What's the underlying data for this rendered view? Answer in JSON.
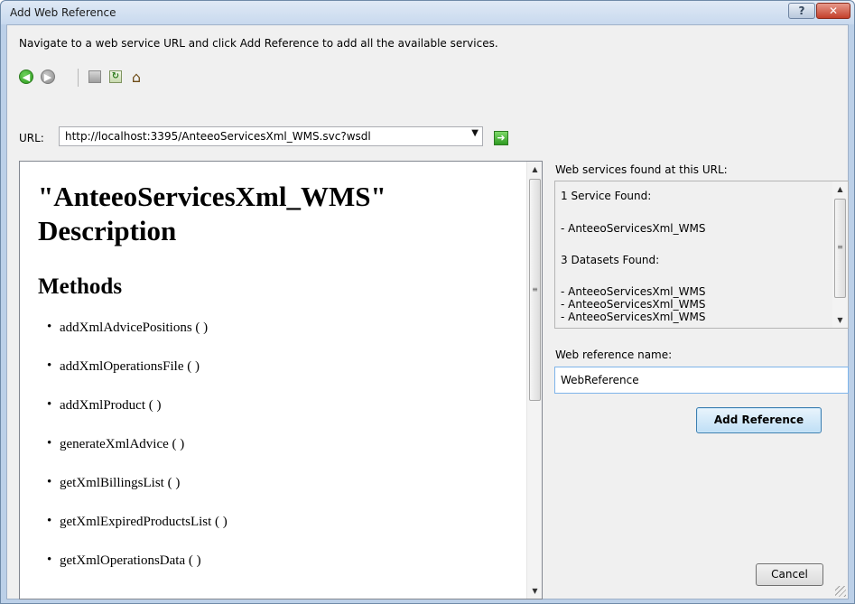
{
  "window": {
    "title": "Add Web Reference",
    "help_glyph": "?",
    "close_glyph": "✕"
  },
  "instruction": "Navigate to a web service URL and click Add Reference to add all the available services.",
  "toolbar": {
    "icons": [
      "back-arrow-icon",
      "forward-arrow-icon",
      "stop-icon",
      "refresh-icon",
      "home-icon"
    ],
    "back_glyph": "◀",
    "forward_glyph": "▶",
    "refresh_glyph": "↻",
    "home_glyph": "⌂"
  },
  "url": {
    "label": "URL:",
    "value": "http://localhost:3395/AnteeoServicesXml_WMS.svc?wsdl",
    "dropdown_glyph": "▼",
    "go_glyph": "➜"
  },
  "description": {
    "heading": "\"AnteeoServicesXml_WMS\" Description",
    "methods_heading": "Methods",
    "methods": [
      "addXmlAdvicePositions ( )",
      "addXmlOperationsFile ( )",
      "addXmlProduct ( )",
      "generateXmlAdvice ( )",
      "getXmlBillingsList ( )",
      "getXmlExpiredProductsList ( )",
      "getXmlOperationsData ( )"
    ],
    "scroll_up_glyph": "▲",
    "scroll_down_glyph": "▼",
    "scroll_grip_glyph": "≡"
  },
  "services_panel": {
    "label": "Web services found at this URL:",
    "lines": [
      "1 Service Found:",
      "- AnteeoServicesXml_WMS",
      "3 Datasets Found:",
      "- AnteeoServicesXml_WMS",
      "- AnteeoServicesXml_WMS",
      "- AnteeoServicesXml_WMS"
    ]
  },
  "reference_name": {
    "label": "Web reference name:",
    "value": "WebReference"
  },
  "buttons": {
    "add_reference": "Add Reference",
    "cancel": "Cancel"
  }
}
